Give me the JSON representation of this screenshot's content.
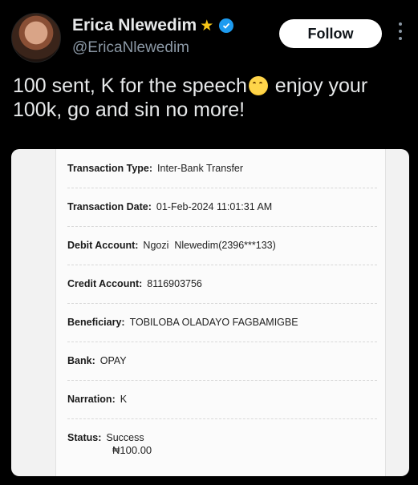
{
  "header": {
    "name": "Erica Nlewedim",
    "handle": "@EricaNlewedim",
    "follow_label": "Follow"
  },
  "tweet": {
    "text_part1": "100 sent, K for the speech",
    "text_part2": " enjoy your 100k, go and sin no more!"
  },
  "receipt": {
    "rows": [
      {
        "label": "Transaction Type:",
        "value": "Inter-Bank Transfer"
      },
      {
        "label": "Transaction Date:",
        "value": "01-Feb-2024 11:01:31 AM"
      },
      {
        "label": "Debit Account:",
        "value": "Ngozi  Nlewedim(2396***133)"
      },
      {
        "label": "Credit Account:",
        "value": "8116903756"
      },
      {
        "label": "Beneficiary:",
        "value": "TOBILOBA OLADAYO FAGBAMIGBE"
      },
      {
        "label": "Bank:",
        "value": "OPAY"
      },
      {
        "label": "Narration:",
        "value": "K"
      },
      {
        "label": "Status:",
        "value": "Success"
      }
    ],
    "amount": "₦100.00"
  },
  "colors": {
    "background": "#000000",
    "verified": "#1d9bf0",
    "star": "#f5c518"
  }
}
